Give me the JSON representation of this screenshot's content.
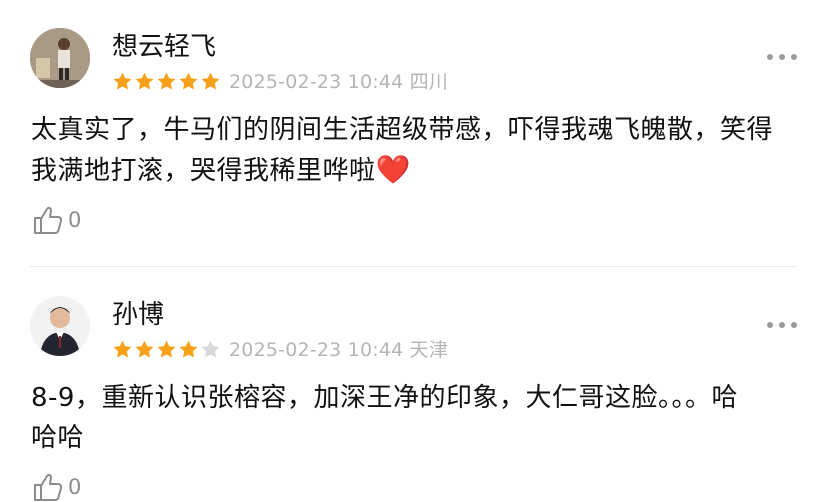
{
  "reviews": [
    {
      "username": "想云轻飞",
      "rating": 5,
      "date": "2025-02-23 10:44",
      "location": "四川",
      "content": "太真实了，牛马们的阴间生活超级带感，吓得我魂飞魄散，笑得我满地打滚，哭得我稀里哗啦",
      "emoji": "❤️",
      "likes": "0"
    },
    {
      "username": "孙博",
      "rating": 4,
      "date": "2025-02-23 10:44",
      "location": "天津",
      "content": "8-9，重新认识张榕容，加深王净的印象，大仁哥这脸。。。哈哈哈",
      "likes": "0"
    }
  ],
  "colors": {
    "star_on": "#f7a01a",
    "star_off": "#d9d9d9",
    "meta": "#b5b5b5"
  },
  "icons": {
    "like": "thumbs-up-icon",
    "more": "more-dots-icon"
  }
}
